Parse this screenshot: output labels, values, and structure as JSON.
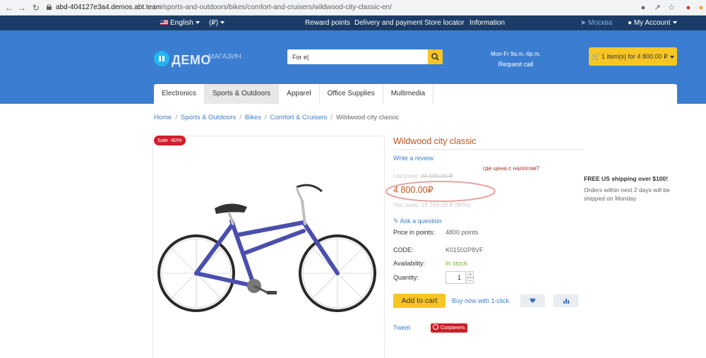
{
  "browser": {
    "url_host": "abd-404127e3a4.demos.abt.team",
    "url_path": "/sports-and-outdoors/bikes/comfort-and-cruisers/wildwood-city-classic-en/"
  },
  "topbar": {
    "language": "English",
    "currency": "(₽)",
    "links": [
      "Reward points",
      "Delivery and payment",
      "Store locator",
      "Information"
    ],
    "city": "Москва",
    "account": "My Account"
  },
  "header": {
    "logo_big": "ДЕМО",
    "logo_small": "МАГАЗИН",
    "search_value": "For e|",
    "hours": "Mon-Fr 9a.m.-6p.m.",
    "request_call": "Request call",
    "cart": "1 item(s) for 4 800.00 ₽"
  },
  "tabs": [
    "Electronics",
    "Sports & Outdoors",
    "Apparel",
    "Office Supplies",
    "Multimedia"
  ],
  "breadcrumb": {
    "items": [
      "Home",
      "Sports & Outdoors",
      "Bikes",
      "Comfort & Cruisers"
    ],
    "current": "Wildwood city classic"
  },
  "product": {
    "sale_badge": "Sale -80%",
    "title": "Wildwood city classic",
    "write_review": "Write a review",
    "annotation": "где цена с налогом?",
    "list_price_label": "List price:",
    "list_price": "24 000.00 ₽",
    "price": "4 800.00₽",
    "you_save": "You save: 19 200.00 ₽ (80%)",
    "ask_question": "Ask a question",
    "points_label": "Price in points:",
    "points_value": "4800 points",
    "code_label": "CODE:",
    "code_value": "K01502P8VF",
    "availability_label": "Availability:",
    "availability_value": "In stock",
    "quantity_label": "Quantity:",
    "quantity_value": "1",
    "add_to_cart": "Add to cart",
    "buy_now": "Buy now with 1-click",
    "tweet": "Tweet",
    "pin": "Сохранить"
  },
  "shipping": {
    "headline": "FREE US shipping over $100!",
    "details": "Orders within next 2 days will be shipped on Monday"
  },
  "colors": {
    "topbar": "#1b3c66",
    "header": "#3b7dd0",
    "accent_yellow": "#f7c524",
    "title_orange": "#c0561f",
    "link_blue": "#3b7dd0",
    "sale_red": "#d41c2c"
  },
  "icons": [
    "back-icon",
    "forward-icon",
    "reload-icon",
    "lock-icon",
    "location-icon",
    "share-icon",
    "star-icon",
    "cart-icon",
    "search-icon",
    "user-icon",
    "comment-icon",
    "heart-icon",
    "compare-icon",
    "pinterest-icon"
  ]
}
